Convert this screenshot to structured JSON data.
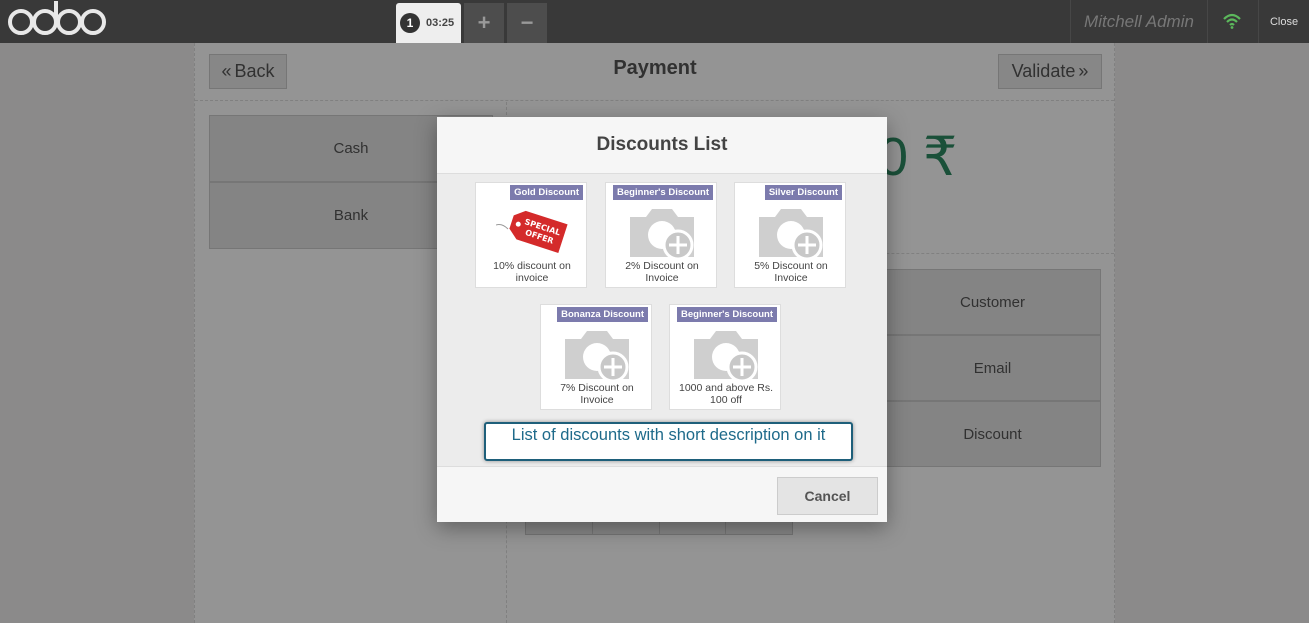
{
  "topbar": {
    "order_number": "1",
    "order_time": "03:25",
    "add_order_label": "+",
    "remove_order_label": "−",
    "user_name": "Mitchell Admin",
    "close_label": "Close",
    "wifi_color": "#5cb85c"
  },
  "payment": {
    "back_label": "Back",
    "title": "Payment",
    "validate_label": "Validate",
    "methods": [
      {
        "label": "Cash"
      },
      {
        "label": "Bank"
      }
    ],
    "amount_visible": "0 ₹",
    "side_buttons": [
      {
        "label": "Customer"
      },
      {
        "label": "Email"
      },
      {
        "label": "Discount"
      }
    ]
  },
  "modal": {
    "title": "Discounts List",
    "cards": [
      {
        "tag": "Gold Discount",
        "description": "10% discount on invoice",
        "image": "special-offer-tag"
      },
      {
        "tag": "Beginner's Discount",
        "description": "2% Discount on Invoice",
        "image": "camera-placeholder"
      },
      {
        "tag": "Silver Discount",
        "description": "5% Discount on Invoice",
        "image": "camera-placeholder"
      },
      {
        "tag": "Bonanza Discount",
        "description": "7% Discount on Invoice",
        "image": "camera-placeholder"
      },
      {
        "tag": "Beginner's Discount",
        "description": "1000 and above Rs. 100 off",
        "image": "camera-placeholder"
      }
    ],
    "cancel_label": "Cancel",
    "tag_color": "#7c7bad"
  },
  "annotation": {
    "text": "List of discounts with short description on it"
  },
  "colors": {
    "topbar": "#393939",
    "amount": "#2d8a62",
    "annotation_border": "#1e5f7a"
  }
}
